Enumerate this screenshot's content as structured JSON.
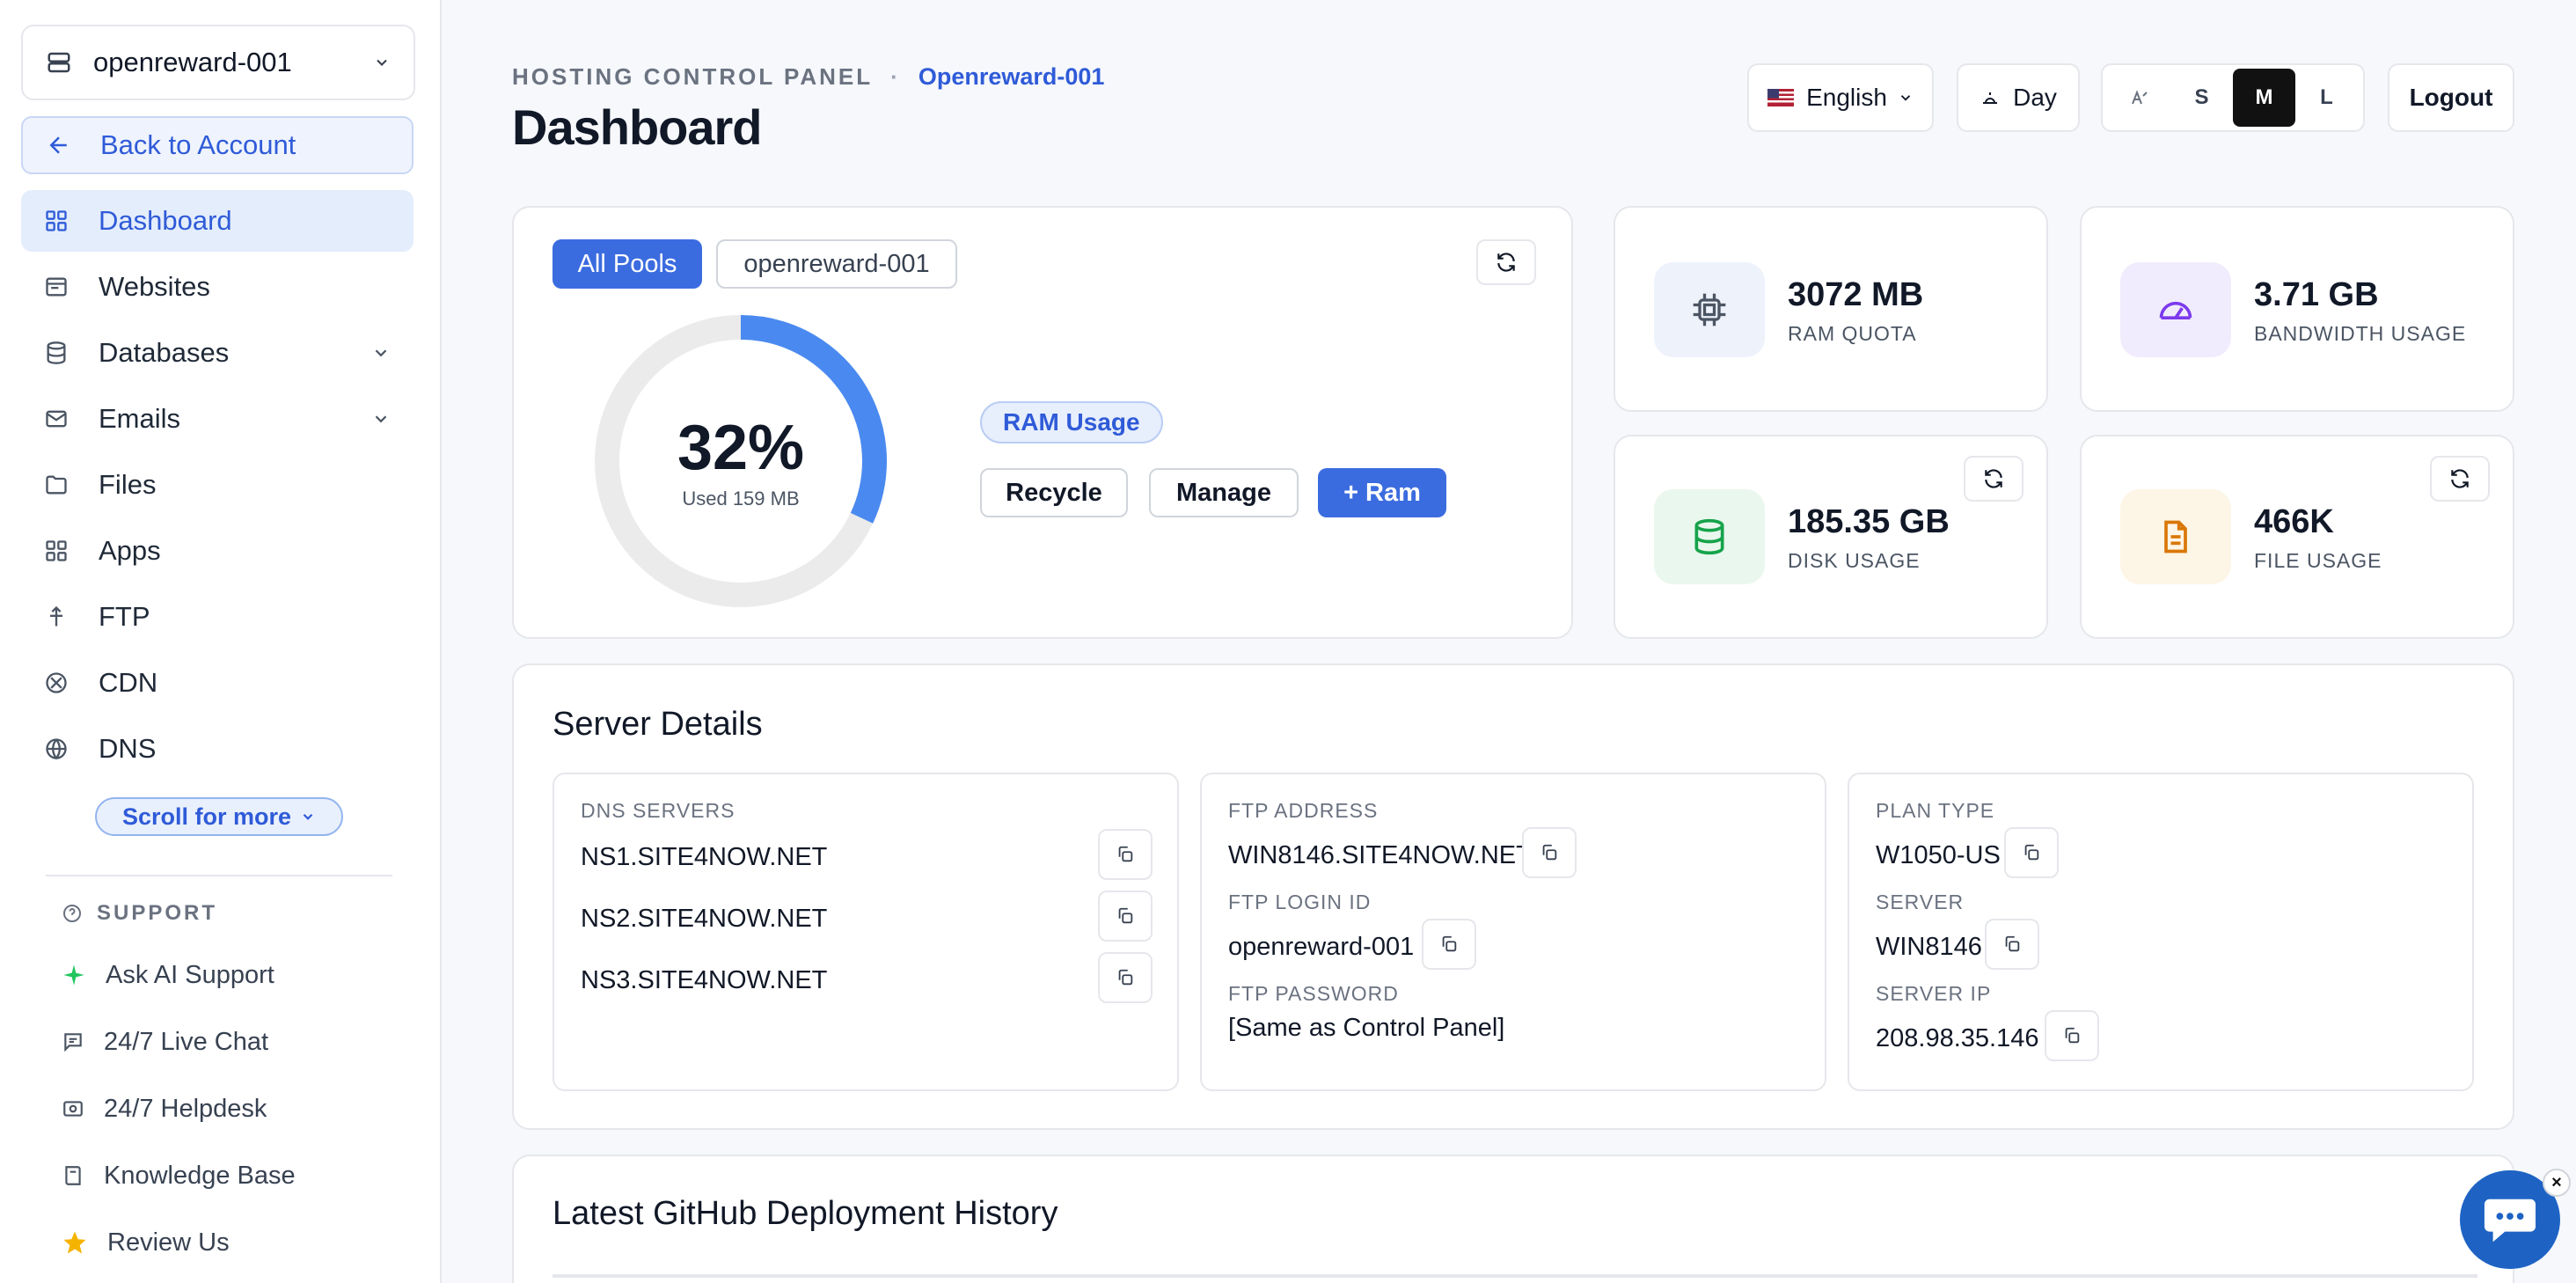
{
  "sidebar": {
    "site_selector": "openreward-001",
    "back_label": "Back to Account",
    "nav": [
      {
        "label": "Dashboard",
        "icon": "grid-icon",
        "active": true
      },
      {
        "label": "Websites",
        "icon": "browser-icon"
      },
      {
        "label": "Databases",
        "icon": "database-icon",
        "expandable": true
      },
      {
        "label": "Emails",
        "icon": "mail-icon",
        "expandable": true
      },
      {
        "label": "Files",
        "icon": "folder-icon"
      },
      {
        "label": "Apps",
        "icon": "apps-icon"
      },
      {
        "label": "FTP",
        "icon": "ftp-icon"
      },
      {
        "label": "CDN",
        "icon": "cdn-icon"
      },
      {
        "label": "DNS",
        "icon": "globe-icon"
      }
    ],
    "scroll_more": "Scroll for more",
    "support_title": "SUPPORT",
    "support": [
      {
        "label": "Ask AI Support",
        "icon": "sparkle-icon"
      },
      {
        "label": "24/7 Live Chat",
        "icon": "chat-icon"
      },
      {
        "label": "24/7 Helpdesk",
        "icon": "helpdesk-icon"
      },
      {
        "label": "Knowledge Base",
        "icon": "book-icon"
      },
      {
        "label": "Review Us",
        "icon": "star-icon"
      }
    ]
  },
  "header": {
    "eyebrow": "HOSTING CONTROL PANEL",
    "site_name": "Openreward-001",
    "title": "Dashboard",
    "language": "English",
    "theme": "Day",
    "sizes": [
      "S",
      "M",
      "L"
    ],
    "active_size": "M",
    "logout": "Logout"
  },
  "ram": {
    "tabs": [
      "All Pools",
      "openreward-001"
    ],
    "percent_label": "32%",
    "percent": 32,
    "used": "Used 159 MB",
    "badge": "RAM Usage",
    "actions": [
      "Recycle",
      "Manage",
      "+ Ram"
    ]
  },
  "stats": [
    {
      "value": "3072 MB",
      "label": "RAM QUOTA",
      "icon": "chip-icon",
      "bg": "#eef2fb",
      "fg": "#4b5563"
    },
    {
      "value": "3.71 GB",
      "label": "BANDWIDTH USAGE",
      "icon": "speedometer-icon",
      "bg": "#f1ecfd",
      "fg": "#7c3aed"
    },
    {
      "value": "185.35 GB",
      "label": "DISK USAGE",
      "icon": "database-icon",
      "bg": "#eaf7ee",
      "fg": "#16a34a"
    },
    {
      "value": "466K",
      "label": "FILE USAGE",
      "icon": "file-icon",
      "bg": "#fdf5e6",
      "fg": "#d97706"
    }
  ],
  "server": {
    "title": "Server Details",
    "dns_label": "DNS SERVERS",
    "dns": [
      "NS1.SITE4NOW.NET",
      "NS2.SITE4NOW.NET",
      "NS3.SITE4NOW.NET"
    ],
    "ftp_address_label": "FTP ADDRESS",
    "ftp_address": "WIN8146.SITE4NOW.NET",
    "ftp_login_label": "FTP LOGIN ID",
    "ftp_login": "openreward-001",
    "ftp_password_label": "FTP PASSWORD",
    "ftp_password": "[Same as Control Panel]",
    "plan_label": "PLAN TYPE",
    "plan": "W1050-US",
    "server_label": "SERVER",
    "server": "WIN8146",
    "ip_label": "SERVER IP",
    "ip": "208.98.35.146"
  },
  "deployments": {
    "title": "Latest GitHub Deployment History"
  },
  "colors": {
    "accent": "#3b6cdf",
    "gauge_track": "#ebebeb",
    "gauge_fill": "#4a8af0"
  }
}
